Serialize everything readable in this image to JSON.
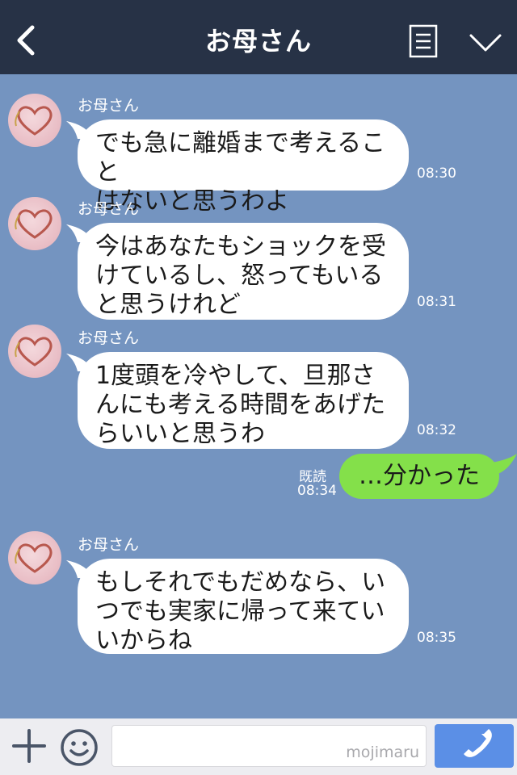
{
  "header": {
    "title": "お母さん",
    "back_icon": "chevron-left-icon",
    "menu_icon": "notes-icon",
    "more_icon": "chevron-down-icon"
  },
  "messages": [
    {
      "sender": "お母さん",
      "text": "でも急に離婚まで考えること\nはないと思うわよ",
      "time": "08:30"
    },
    {
      "sender": "お母さん",
      "text": "今はあなたもショックを受\nけているし、怒ってもいる\nと思うけれど",
      "time": "08:31"
    },
    {
      "sender": "お母さん",
      "text": "1度頭を冷やして、旦那さ\nんにも考える時間をあげた\nらいいと思うわ",
      "time": "08:32"
    },
    {
      "sender": "お母さん",
      "text": "もしそれでもだめなら、い\nつでも実家に帰って来てい\nいからね",
      "time": "08:35"
    }
  ],
  "outgoing": {
    "text": "…分かった",
    "read_label": "既読",
    "time": "08:34"
  },
  "footer": {
    "plus_icon": "plus-icon",
    "emoji_icon": "smiley-icon",
    "input_placeholder": "",
    "watermark": "mojimaru",
    "call_icon": "phone-icon"
  },
  "colors": {
    "header_bg": "#273246",
    "chat_bg": "#7494c0",
    "incoming_bubble": "#ffffff",
    "outgoing_bubble": "#84e04a",
    "call_button": "#5b8fe6"
  }
}
